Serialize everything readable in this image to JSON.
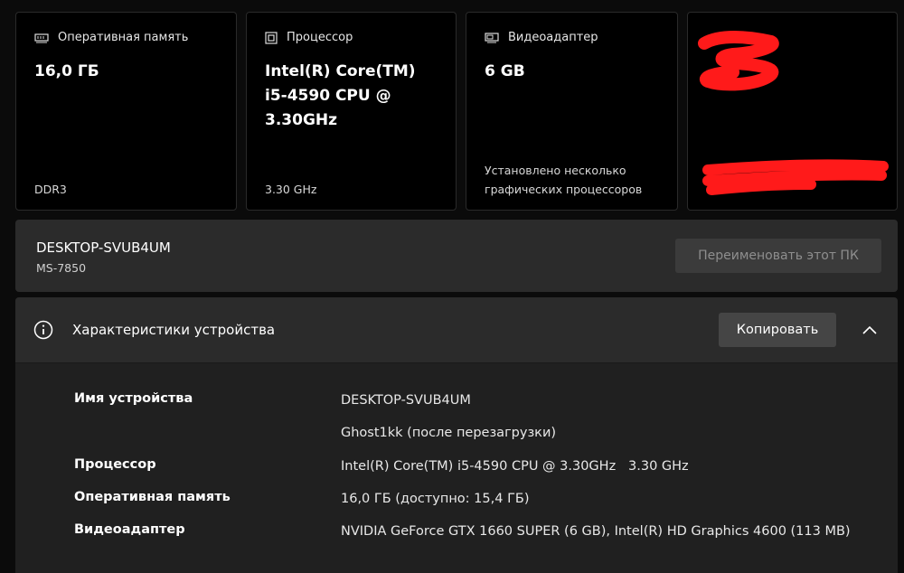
{
  "cards": [
    {
      "title": "Оперативная память",
      "icon": "memory-icon",
      "value": "16,0 ГБ",
      "detail": "DDR3"
    },
    {
      "title": "Процессор",
      "icon": "processor-icon",
      "value": "Intel(R) Core(TM) i5-4590 CPU @ 3.30GHz",
      "detail": "3.30 GHz"
    },
    {
      "title": "Видеоадаптер",
      "icon": "display-adapter-icon",
      "value": "6 GB",
      "detail": "Установлено несколько графических процессоров"
    }
  ],
  "device": {
    "name": "DESKTOP-SVUB4UM",
    "model": "MS-7850",
    "rename_label": "Переименовать этот ПК"
  },
  "specs": {
    "title": "Характеристики устройства",
    "copy_label": "Копировать",
    "rows": [
      {
        "label": "Имя устройства",
        "value": "DESKTOP-SVUB4UM"
      },
      {
        "label": "",
        "value": "Ghost1kk (после перезагрузки)"
      },
      {
        "label": "Процессор",
        "value": "Intel(R) Core(TM) i5-4590 CPU @ 3.30GHz   3.30 GHz"
      },
      {
        "label": "Оперативная память",
        "value": "16,0 ГБ (доступно: 15,4 ГБ)"
      },
      {
        "label": "Видеоадаптер",
        "value": "NVIDIA GeForce GTX 1660 SUPER (6 GB), Intel(R) HD Graphics 4600 (113 MB)"
      }
    ]
  },
  "colors": {
    "redaction": "#ff1a1a",
    "button_disabled": "#3b3b3b"
  }
}
